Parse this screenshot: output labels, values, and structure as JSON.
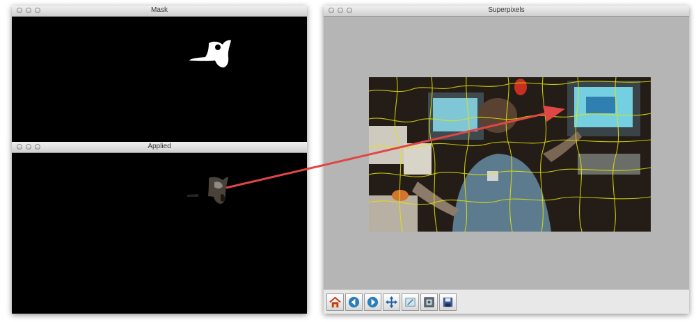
{
  "windows": {
    "mask": {
      "title": "Mask"
    },
    "applied": {
      "title": "Applied"
    },
    "superpixels": {
      "title": "Superpixels"
    }
  },
  "toolbar": {
    "icons": [
      "home-icon",
      "back-icon",
      "forward-icon",
      "pan-icon",
      "zoom-icon",
      "configure-icon",
      "save-icon"
    ]
  },
  "colors": {
    "arrow": "#e04646",
    "superpixel_boundary": "#e6e600",
    "canvas_background": "#b5b5b5"
  }
}
